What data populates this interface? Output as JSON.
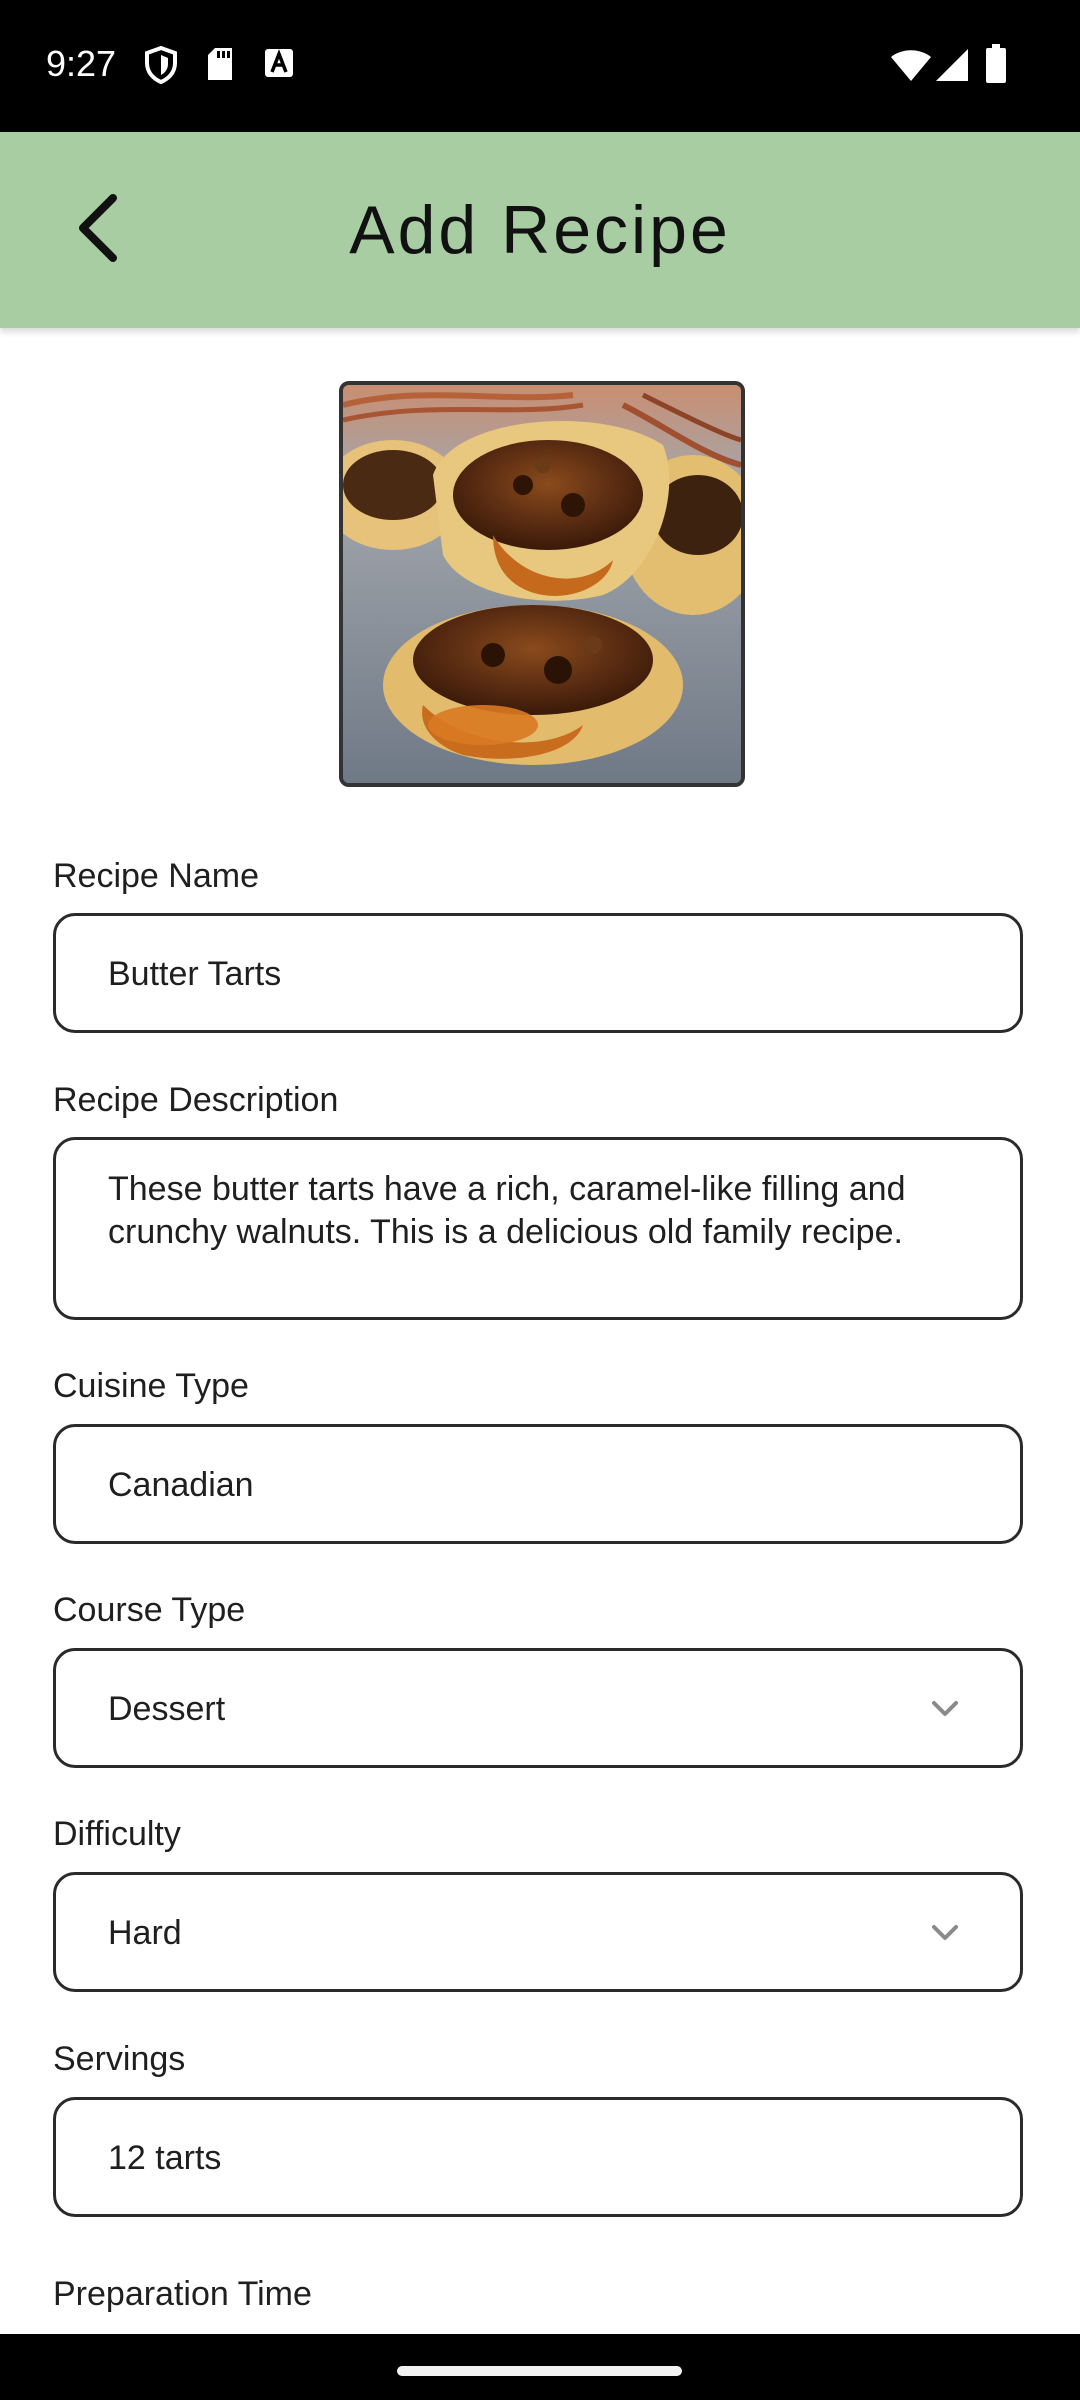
{
  "status_bar": {
    "time": "9:27",
    "left_icons": [
      "shield-icon",
      "sd-card-icon",
      "keyboard-a-icon"
    ],
    "right_icons": [
      "wifi-icon",
      "signal-icon",
      "battery-icon"
    ]
  },
  "app_bar": {
    "title": "Add Recipe",
    "back_icon": "chevron-left-icon",
    "color": "#a8cda3"
  },
  "recipe_image": {
    "subject": "butter tarts photo"
  },
  "form": {
    "recipe_name": {
      "label": "Recipe Name",
      "value": "Butter Tarts"
    },
    "recipe_description": {
      "label": "Recipe Description",
      "value": "These butter tarts have a rich, caramel-like filling and crunchy walnuts. This is a delicious old family recipe."
    },
    "cuisine_type": {
      "label": "Cuisine Type",
      "value": "Canadian"
    },
    "course_type": {
      "label": "Course Type",
      "value": "Dessert"
    },
    "difficulty": {
      "label": "Difficulty",
      "value": "Hard"
    },
    "servings": {
      "label": "Servings",
      "value": "12 tarts"
    },
    "preparation_time": {
      "label": "Preparation Time"
    }
  }
}
